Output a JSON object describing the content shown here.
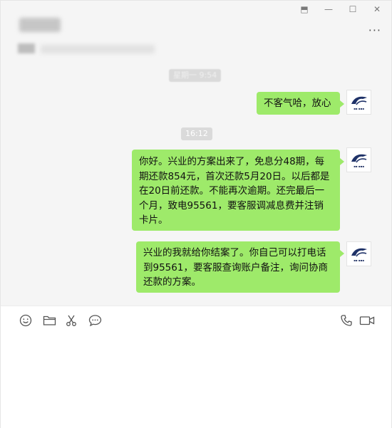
{
  "window": {
    "controls": {
      "pin": "⬒",
      "minimize": "—",
      "maximize": "☐",
      "close": "✕"
    },
    "more": "···"
  },
  "chat": {
    "timestamps": [
      "星期一 9:54",
      "16:12"
    ],
    "messages": [
      "不客气哈，放心",
      "你好。兴业的方案出来了，免息分48期，每期还款854元，首次还款5月20日。以后都是在20日前还款。不能再次逾期。还完最后一个月，致电95561，要客服调减息费并注销卡片。",
      "兴业的我就给你结案了。你自己可以打电话到95561，要客服查询账户备注，询问协商还款的方案。"
    ],
    "bubble_color": "#9eea6a",
    "background_color": "#f5f5f5"
  },
  "toolbar": {
    "left_icons": [
      "emoji-icon",
      "folder-icon",
      "scissors-icon",
      "chat-bubble-icon"
    ],
    "right_icons": [
      "phone-icon",
      "video-icon"
    ]
  }
}
